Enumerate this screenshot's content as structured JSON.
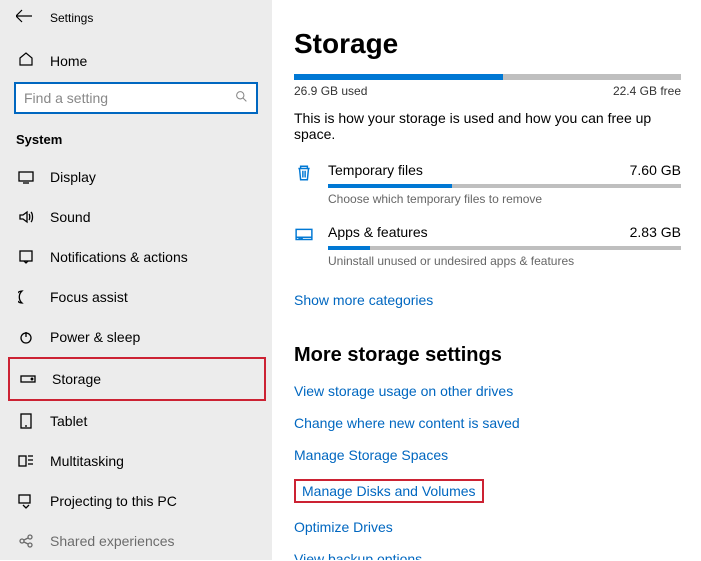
{
  "titlebar": {
    "title": "Settings"
  },
  "home": {
    "label": "Home"
  },
  "search": {
    "placeholder": "Find a setting"
  },
  "section": {
    "label": "System"
  },
  "nav": {
    "display": "Display",
    "sound": "Sound",
    "notifications": "Notifications & actions",
    "focus": "Focus assist",
    "power": "Power & sleep",
    "storage": "Storage",
    "tablet": "Tablet",
    "multitasking": "Multitasking",
    "projecting": "Projecting to this PC",
    "shared": "Shared experiences"
  },
  "page": {
    "title": "Storage"
  },
  "usage": {
    "used": "26.9 GB used",
    "free": "22.4 GB free",
    "percent": 54,
    "desc": "This is how your storage is used and how you can free up space."
  },
  "categories": [
    {
      "name": "Temporary files",
      "size": "7.60 GB",
      "percent": 35,
      "hint": "Choose which temporary files to remove"
    },
    {
      "name": "Apps & features",
      "size": "2.83 GB",
      "percent": 12,
      "hint": "Uninstall unused or undesired apps & features"
    }
  ],
  "show_more": "Show more categories",
  "more": {
    "title": "More storage settings",
    "links": {
      "other_drives": "View storage usage on other drives",
      "change_location": "Change where new content is saved",
      "storage_spaces": "Manage Storage Spaces",
      "disks_volumes": "Manage Disks and Volumes",
      "optimize": "Optimize Drives",
      "backup": "View backup options"
    }
  }
}
